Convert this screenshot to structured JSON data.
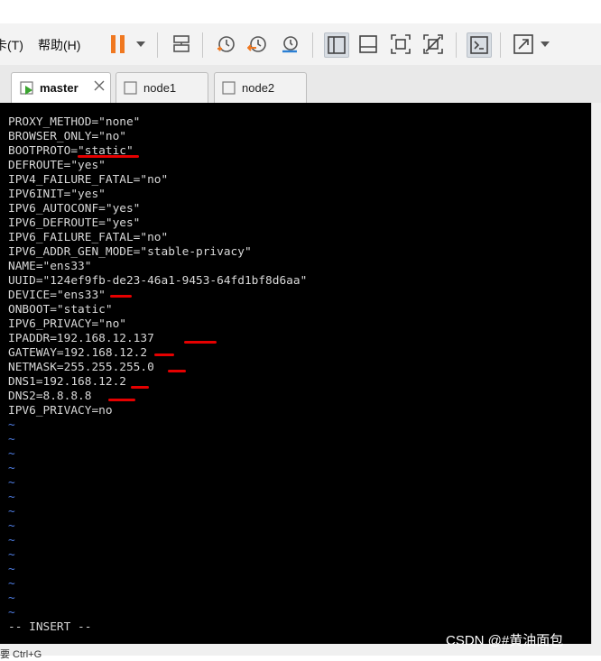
{
  "menu": {
    "tools_partial": "卡(T)",
    "help": "帮助(H)"
  },
  "toolbar": {
    "icons": [
      "pause-icon",
      "send-ctrl-alt-del-icon",
      "snapshot-icon",
      "revert-snapshot-icon",
      "manage-snapshots-icon",
      "normal-view-icon",
      "thumbnail-view-icon",
      "fullscreen-icon",
      "unity-icon",
      "console-view-icon",
      "stretch-icon"
    ],
    "accent_orange": "#f07820"
  },
  "tabs": [
    {
      "label": "master",
      "active": true
    },
    {
      "label": "node1",
      "active": false
    },
    {
      "label": "node2",
      "active": false
    }
  ],
  "terminal": {
    "lines": [
      "PROXY_METHOD=\"none\"",
      "BROWSER_ONLY=\"no\"",
      "BOOTPROTO=\"static\"",
      "DEFROUTE=\"yes\"",
      "IPV4_FAILURE_FATAL=\"no\"",
      "IPV6INIT=\"yes\"",
      "IPV6_AUTOCONF=\"yes\"",
      "IPV6_DEFROUTE=\"yes\"",
      "IPV6_FAILURE_FATAL=\"no\"",
      "IPV6_ADDR_GEN_MODE=\"stable-privacy\"",
      "NAME=\"ens33\"",
      "UUID=\"124ef9fb-de23-46a1-9453-64fd1bf8d6aa\"",
      "DEVICE=\"ens33\"",
      "ONBOOT=\"static\"",
      "IPV6_PRIVACY=\"no\"",
      "IPADDR=192.168.12.137",
      "GATEWAY=192.168.12.2",
      "NETMASK=255.255.255.0",
      "DNS1=192.168.12.2",
      "DNS2=8.8.8.8",
      "IPV6_PRIVACY=no"
    ],
    "tilde": "~",
    "mode": "-- INSERT --",
    "background": "#000000",
    "tilde_color": "#4f7ee6",
    "annotation_color": "#e50000"
  },
  "status": {
    "text": "要 Ctrl+G"
  },
  "watermark": "CSDN @#黄油面包"
}
